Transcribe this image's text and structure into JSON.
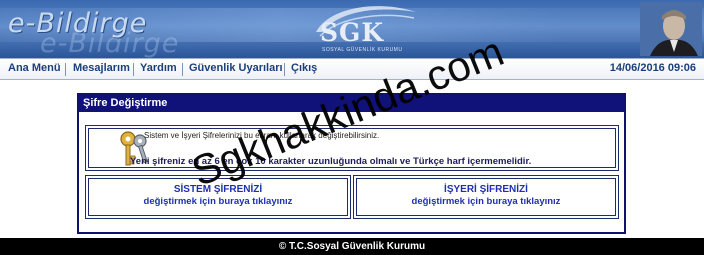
{
  "header": {
    "app_title": "e-Bildirge",
    "logo_text": "SGK",
    "logo_subtitle": "SOSYAL GÜVENLİK KURUMU"
  },
  "menu": {
    "items": [
      {
        "label": "Ana Menü"
      },
      {
        "label": "Mesajlarım"
      },
      {
        "label": "Yardım"
      },
      {
        "label": "Güvenlik Uyarıları"
      },
      {
        "label": "Çıkış"
      }
    ],
    "datetime": "14/06/2016 09:06"
  },
  "panel": {
    "title": "Şifre Değiştirme",
    "info_text": "Sistem ve İşyeri Şifrelerinizi bu ekranı kullanarak değiştirebilirsiniz.",
    "rule_text": "Yeni şifreniz en az 6 en çok 10 karakter uzunluğunda olmalı ve Türkçe harf içermemelidir.",
    "links": [
      {
        "title": "SİSTEM ŞİFRENİZİ",
        "subtitle": "değiştirmek için buraya tıklayınız"
      },
      {
        "title": "İŞYERİ ŞİFRENİZİ",
        "subtitle": "değiştirmek için buraya tıklayınız"
      }
    ]
  },
  "footer": {
    "text": "© T.C.Sosyal Güvenlik Kurumu"
  },
  "watermark": {
    "text": "Sgkhakkinda.com"
  },
  "colors": {
    "banner": "#3a69b0",
    "menu_text": "#1c3f7a",
    "panel_header": "#11117a",
    "link_text": "#1f2fb0",
    "footer": "#000000"
  },
  "icons": {
    "keys": "keys-icon",
    "portrait": "portrait-image"
  }
}
